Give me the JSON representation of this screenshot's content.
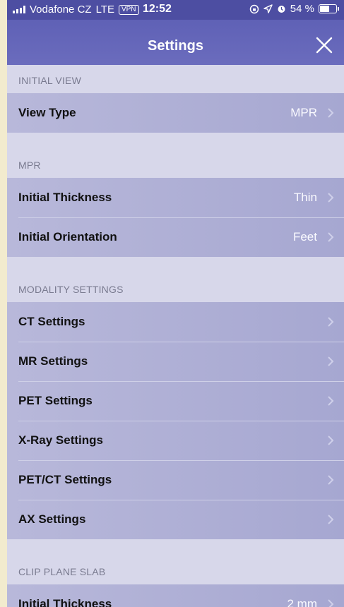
{
  "status": {
    "carrier": "Vodafone CZ",
    "network": "LTE",
    "vpn": "VPN",
    "time": "12:52",
    "battery": "54 %"
  },
  "nav": {
    "title": "Settings"
  },
  "sections": {
    "initial_view": {
      "header": "INITIAL VIEW",
      "view_type": {
        "label": "View Type",
        "value": "MPR"
      }
    },
    "mpr": {
      "header": "MPR",
      "initial_thickness": {
        "label": "Initial Thickness",
        "value": "Thin"
      },
      "initial_orientation": {
        "label": "Initial Orientation",
        "value": "Feet"
      }
    },
    "modality": {
      "header": "MODALITY SETTINGS",
      "ct": {
        "label": "CT Settings"
      },
      "mr": {
        "label": "MR Settings"
      },
      "pet": {
        "label": "PET Settings"
      },
      "xray": {
        "label": "X-Ray Settings"
      },
      "petct": {
        "label": "PET/CT Settings"
      },
      "ax": {
        "label": "AX Settings"
      }
    },
    "clip": {
      "header": "CLIP PLANE SLAB",
      "initial_thickness": {
        "label": "Initial Thickness",
        "value": "2 mm"
      }
    }
  },
  "colors": {
    "nav_bar": "#5f61b6",
    "row_background": "#b0b1d6",
    "section_header_text": "#7a7b90"
  }
}
